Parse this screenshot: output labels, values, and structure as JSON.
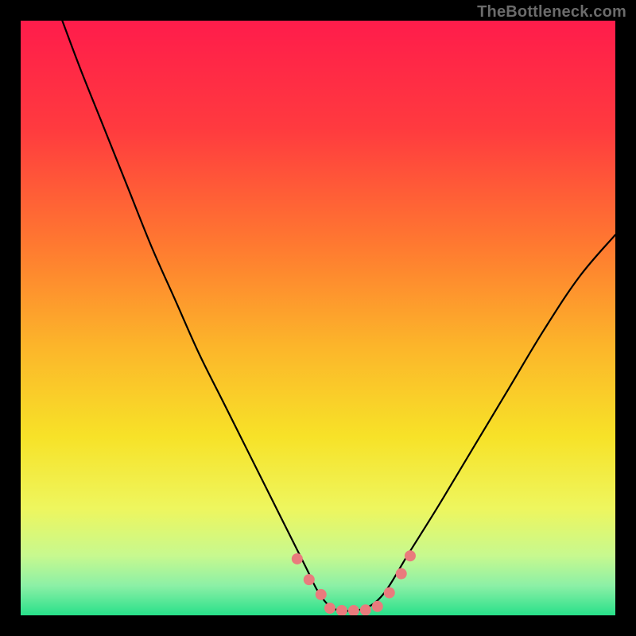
{
  "watermark": "TheBottleneck.com",
  "chart_data": {
    "type": "line",
    "title": "",
    "xlabel": "",
    "ylabel": "",
    "xlim": [
      0,
      100
    ],
    "ylim": [
      0,
      100
    ],
    "background_gradient": {
      "stops": [
        {
          "offset": 0,
          "color": "#ff1c4b"
        },
        {
          "offset": 18,
          "color": "#ff3a3f"
        },
        {
          "offset": 38,
          "color": "#ff7a30"
        },
        {
          "offset": 55,
          "color": "#fcb62a"
        },
        {
          "offset": 70,
          "color": "#f7e228"
        },
        {
          "offset": 82,
          "color": "#eef65e"
        },
        {
          "offset": 90,
          "color": "#c7f98f"
        },
        {
          "offset": 95,
          "color": "#8cf0a6"
        },
        {
          "offset": 100,
          "color": "#28e08a"
        }
      ]
    },
    "series": [
      {
        "name": "bottleneck-curve",
        "color": "#000000",
        "width": 2.2,
        "x": [
          7,
          10,
          14,
          18,
          22,
          26,
          30,
          34,
          38,
          42,
          45,
          48,
          50,
          52,
          54,
          56,
          58,
          60,
          62,
          65,
          70,
          76,
          82,
          88,
          94,
          100
        ],
        "y": [
          100,
          92,
          82,
          72,
          62,
          53,
          44,
          36,
          28,
          20,
          14,
          8,
          4,
          1.5,
          0.8,
          0.8,
          1.2,
          2.5,
          5,
          10,
          18,
          28,
          38,
          48,
          57,
          64
        ]
      }
    ],
    "markers": {
      "name": "optimal-band-markers",
      "color": "#e97b7d",
      "radius": 7,
      "points": [
        {
          "x": 46.5,
          "y": 9.5
        },
        {
          "x": 48.5,
          "y": 6
        },
        {
          "x": 50.5,
          "y": 3.5
        },
        {
          "x": 52,
          "y": 1.2
        },
        {
          "x": 54,
          "y": 0.8
        },
        {
          "x": 56,
          "y": 0.8
        },
        {
          "x": 58,
          "y": 0.9
        },
        {
          "x": 60,
          "y": 1.5
        },
        {
          "x": 62,
          "y": 3.8
        },
        {
          "x": 64,
          "y": 7
        },
        {
          "x": 65.5,
          "y": 10
        }
      ]
    }
  }
}
